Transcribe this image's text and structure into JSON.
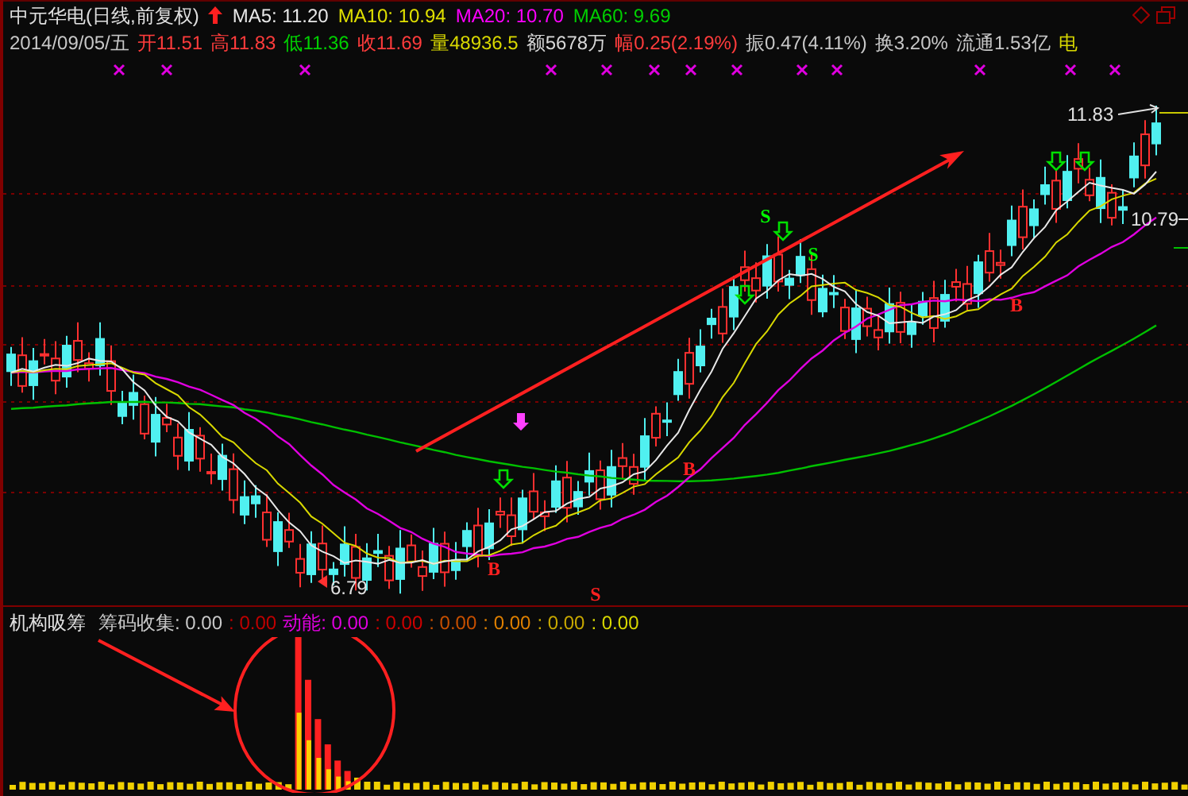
{
  "header": {
    "title": "中元华电(日线,前复权)",
    "ma": [
      {
        "label": "MA5: 11.20",
        "color": "#e8e8e8"
      },
      {
        "label": "MA10: 10.94",
        "color": "#e0e000"
      },
      {
        "label": "MA20: 10.70",
        "color": "#ff00ff"
      },
      {
        "label": "MA60: 9.69",
        "color": "#00d000"
      }
    ]
  },
  "quote": [
    {
      "text": "2014/09/05/五",
      "color": "#c8c8c8"
    },
    {
      "text": "开11.51",
      "color": "#ff3c3c"
    },
    {
      "text": "高11.83",
      "color": "#ff3c3c"
    },
    {
      "text": "低11.36",
      "color": "#00d000"
    },
    {
      "text": "收11.69",
      "color": "#ff3c3c"
    },
    {
      "text": "量48936.5",
      "color": "#d8d800"
    },
    {
      "text": "额5678万",
      "color": "#d8d8d8"
    },
    {
      "text": "幅0.25(2.19%)",
      "color": "#ff3c3c"
    },
    {
      "text": "振0.47(4.11%)",
      "color": "#c8c8c8"
    },
    {
      "text": "换3.20%",
      "color": "#c8c8c8"
    },
    {
      "text": "流通1.53亿",
      "color": "#c8c8c8"
    },
    {
      "text": "电",
      "color": "#d8d800"
    }
  ],
  "chart": {
    "high_label": "11.83",
    "right_label": "10.79",
    "low_label": "6.79",
    "signals": [
      {
        "text": "S",
        "color": "#00ff00"
      },
      {
        "text": "S",
        "color": "#00ff00"
      },
      {
        "text": "B",
        "color": "#ff2020"
      },
      {
        "text": "B",
        "color": "#ff2020"
      },
      {
        "text": "B",
        "color": "#ff2020"
      },
      {
        "text": "S",
        "color": "#ff2020"
      }
    ]
  },
  "indicator": {
    "title": "机构吸筹",
    "values": [
      {
        "text": "筹码收集: 0.00",
        "color": "#c8c8c8"
      },
      {
        "text": ": 0.00",
        "color": "#c00000"
      },
      {
        "text": "动能: 0.00",
        "color": "#e000e0"
      },
      {
        "text": ": 0.00",
        "color": "#d00000"
      },
      {
        "text": ": 0.00",
        "color": "#c85000"
      },
      {
        "text": ": 0.00",
        "color": "#e08000"
      },
      {
        "text": ": 0.00",
        "color": "#c8a800"
      },
      {
        "text": ": 0.00",
        "color": "#d8d800"
      }
    ]
  }
}
